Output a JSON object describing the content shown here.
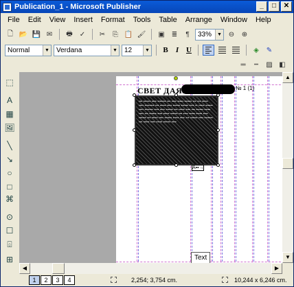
{
  "window": {
    "title": "Publication_1 - Microsoft Publisher"
  },
  "menu": [
    "File",
    "Edit",
    "View",
    "Insert",
    "Format",
    "Tools",
    "Table",
    "Arrange",
    "Window",
    "Help"
  ],
  "toolbar": {
    "zoom": "33%"
  },
  "formatting": {
    "style": "Normal",
    "font": "Verdana",
    "size": "12"
  },
  "document": {
    "headline": "СВЕТ ДАЯНЬЯ",
    "small_label": "№ 1 (1)",
    "overflow": "A▪▪→"
  },
  "tooltip": {
    "text": "Text"
  },
  "status": {
    "pages": [
      "1",
      "2",
      "3",
      "4"
    ],
    "active_page": "1",
    "position": "2,254; 3,754 cm.",
    "size": "10,244 x 6,246 cm."
  },
  "colors": {
    "title_bar": "#0a5bd8",
    "workspace": "#a9a9a9",
    "chrome": "#ece9d8"
  }
}
